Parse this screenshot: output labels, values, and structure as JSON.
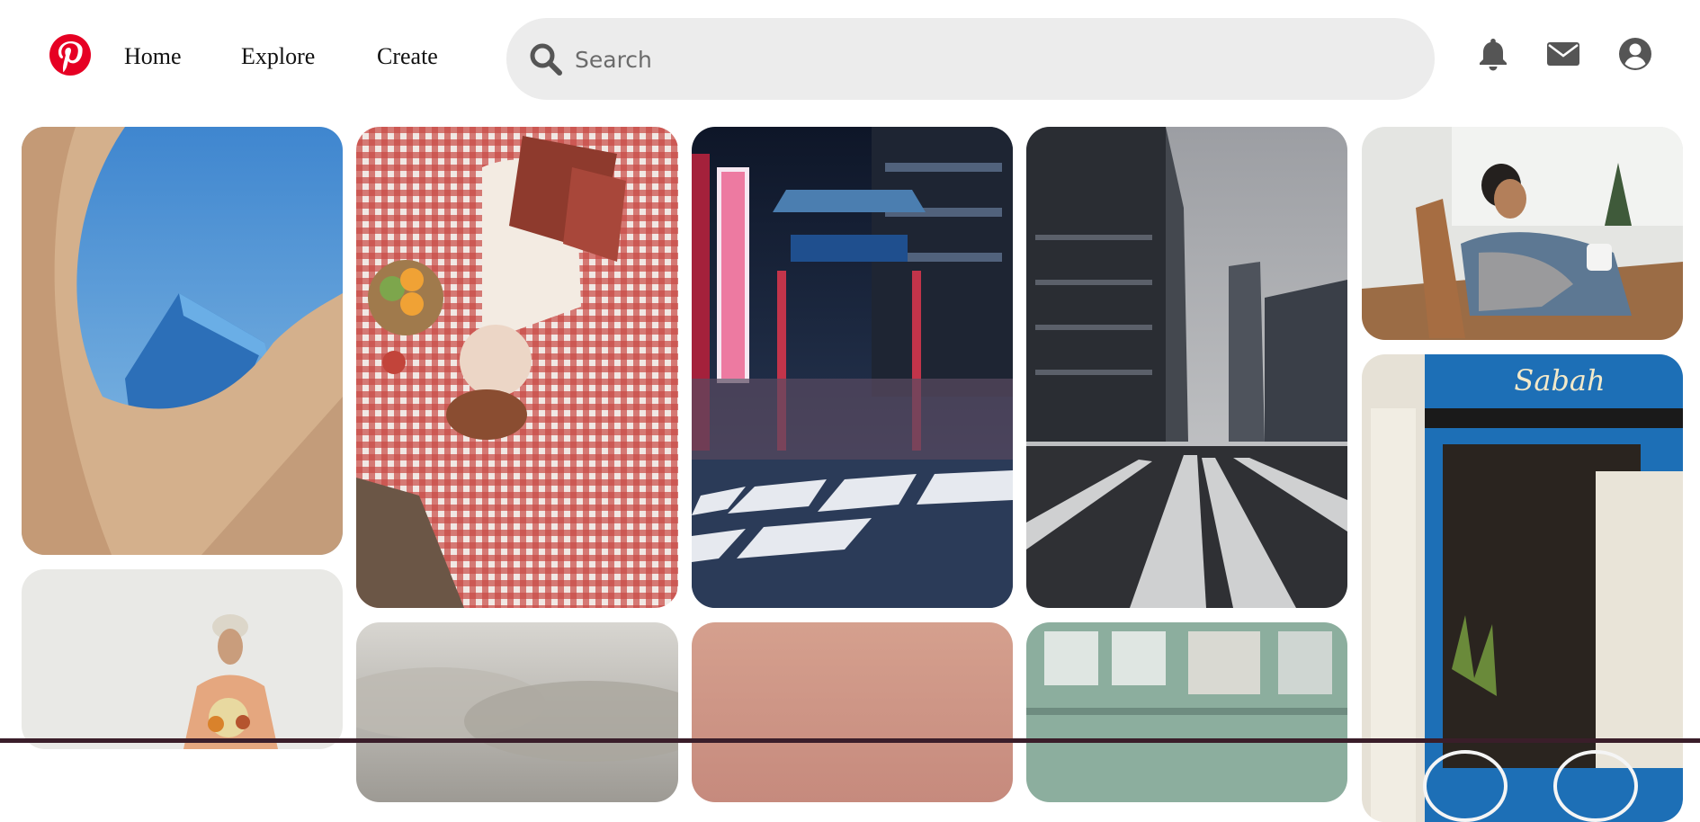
{
  "header": {
    "logo_icon": "pinterest-logo-icon",
    "brand_color": "#e60023",
    "nav": [
      {
        "label": "Home"
      },
      {
        "label": "Explore"
      },
      {
        "label": "Create"
      }
    ],
    "search": {
      "placeholder": "Search",
      "value": "",
      "icon": "search-icon"
    },
    "icons": [
      "bell-icon",
      "envelope-icon",
      "user-icon"
    ]
  },
  "pins": [
    {
      "subject": "curved brick building with blue sky"
    },
    {
      "subject": "woman lying on red gingham picnic blanket with book"
    },
    {
      "subject": "Chinatown gate at night with neon signs"
    },
    {
      "subject": "city street crosswalk between skyscrapers"
    },
    {
      "subject": "woman on couch holding baby and mug"
    },
    {
      "subject": "woman with bouquet against pale sky"
    },
    {
      "subject": "misty clouds"
    },
    {
      "subject": "pink gradient sky"
    },
    {
      "subject": "green building facade with balconies"
    },
    {
      "subject": "blue cafe storefront with white chairs"
    }
  ],
  "sign_text": "Sabah"
}
